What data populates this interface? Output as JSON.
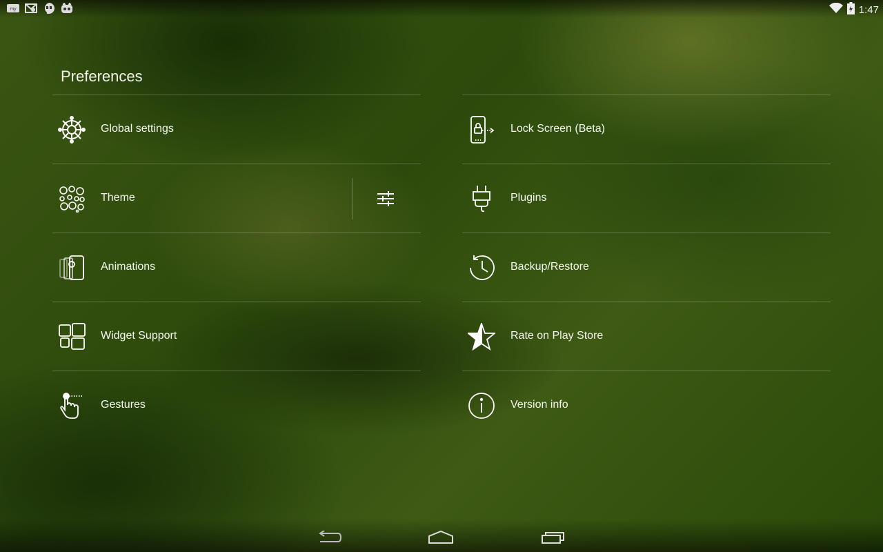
{
  "status": {
    "icons": [
      "my-app-icon",
      "mail-notification-icon",
      "hangouts-icon",
      "cyanogenmod-icon"
    ],
    "wifi": "wifi-icon",
    "battery": "battery-charging-icon",
    "time": "1:47"
  },
  "page": {
    "title": "Preferences"
  },
  "left_items": [
    {
      "label": "Global settings",
      "icon": "settings-wheel-icon"
    },
    {
      "label": "Theme",
      "icon": "theme-bubbles-icon"
    },
    {
      "label": "Animations",
      "icon": "animations-icon"
    },
    {
      "label": "Widget Support",
      "icon": "widgets-icon"
    },
    {
      "label": "Gestures",
      "icon": "gesture-hand-icon"
    }
  ],
  "right_items": [
    {
      "label": "Lock Screen (Beta)",
      "icon": "lock-screen-icon"
    },
    {
      "label": "Plugins",
      "icon": "plug-icon"
    },
    {
      "label": "Backup/Restore",
      "icon": "history-icon"
    },
    {
      "label": "Rate on Play Store",
      "icon": "star-icon"
    },
    {
      "label": "Version info",
      "icon": "info-icon"
    }
  ],
  "theme_action": {
    "icon": "tune-sliders-icon"
  },
  "nav": {
    "back": "back-icon",
    "home": "home-icon",
    "recents": "recents-icon"
  }
}
